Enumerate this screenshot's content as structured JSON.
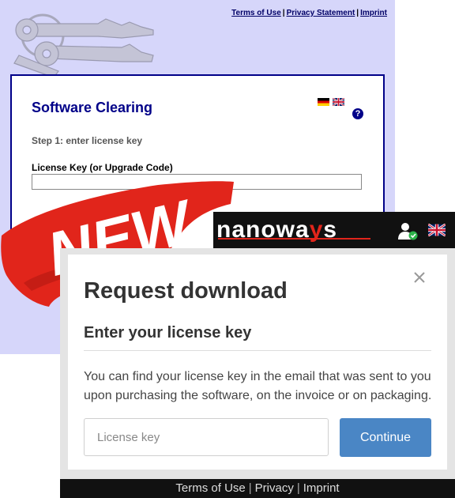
{
  "old_page": {
    "links": {
      "terms": "Terms of Use",
      "privacy": "Privacy Statement",
      "imprint": "Imprint",
      "separator": "|"
    },
    "title": "Software Clearing",
    "step": "Step 1: enter license key",
    "field_label": "License Key (or Upgrade Code)",
    "help": "?"
  },
  "badge": {
    "text": "NEW",
    "color": "#e1251b"
  },
  "header": {
    "logo_text_a": "nanowa",
    "logo_text_b": "y",
    "logo_text_c": "s",
    "account_icon": "user-check-icon",
    "language_icon": "uk-flag-icon"
  },
  "modal": {
    "title": "Request download",
    "subtitle": "Enter your license key",
    "description": "You can find your license key in the email that was sent to you upon purchasing the software, on the invoice or on packaging.",
    "input": {
      "placeholder": "License key",
      "value": ""
    },
    "continue_label": "Continue",
    "close_icon": "close-icon",
    "accent_color": "#4a86c5"
  },
  "footer": {
    "terms": "Terms of Use",
    "privacy": "Privacy",
    "imprint": "Imprint",
    "separator": "|"
  }
}
